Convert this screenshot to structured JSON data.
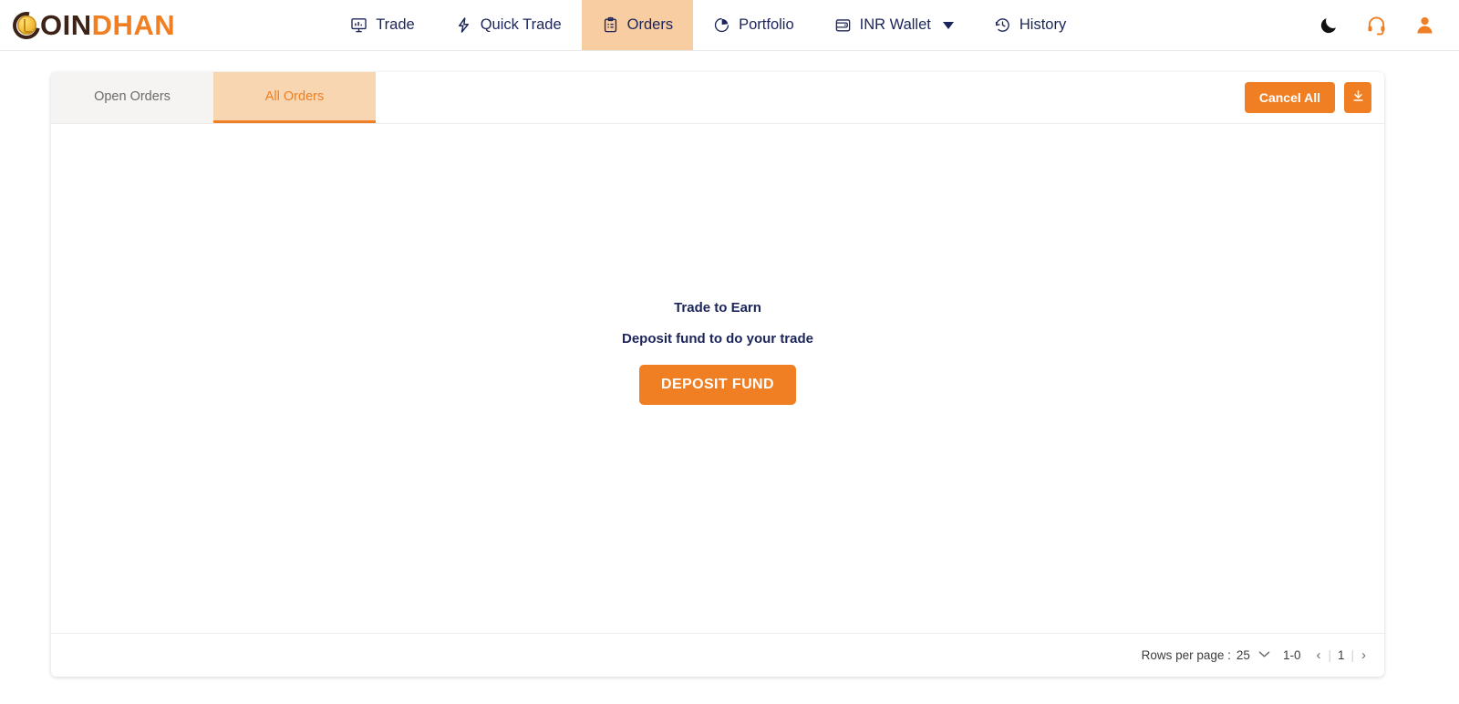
{
  "brand": {
    "logo_letter": "C",
    "logo_part_dark": "OIN",
    "logo_part_orange": "DHAN",
    "accent_color": "#ef7f22",
    "dark_color": "#3d2317",
    "navy_color": "#1b2559"
  },
  "header": {
    "nav": [
      {
        "label": "Trade",
        "icon": "monitor-chart-icon",
        "active": false,
        "caret": false
      },
      {
        "label": "Quick Trade",
        "icon": "lightning-bolt-icon",
        "active": false,
        "caret": false
      },
      {
        "label": "Orders",
        "icon": "clipboard-icon",
        "active": true,
        "caret": false
      },
      {
        "label": "Portfolio",
        "icon": "pie-chart-icon",
        "active": false,
        "caret": false
      },
      {
        "label": "INR Wallet",
        "icon": "wallet-icon",
        "active": false,
        "caret": true
      },
      {
        "label": "History",
        "icon": "clock-history-icon",
        "active": false,
        "caret": false
      }
    ],
    "actions": [
      {
        "name": "dark-mode-toggle",
        "icon": "moon-icon",
        "color": "#111111"
      },
      {
        "name": "support-button",
        "icon": "headset-icon",
        "color": "#ef7f22"
      },
      {
        "name": "account-button",
        "icon": "user-icon",
        "color": "#ef7f22"
      }
    ]
  },
  "orders_card": {
    "tabs": [
      {
        "label": "Open Orders",
        "active": false
      },
      {
        "label": "All Orders",
        "active": true
      }
    ],
    "cancel_all_label": "Cancel All",
    "download_icon": "download-icon",
    "empty_state": {
      "title": "Trade to Earn",
      "subtitle": "Deposit fund to do your trade",
      "button_label": "DEPOSIT FUND"
    },
    "footer": {
      "rows_per_page_label": "Rows per page :",
      "rows_per_page_value": "25",
      "rows_per_page_options": [
        "25"
      ],
      "range": "1-0",
      "page_number": "1",
      "prev_glyph": "‹",
      "next_glyph": "›",
      "separator": "|"
    }
  }
}
